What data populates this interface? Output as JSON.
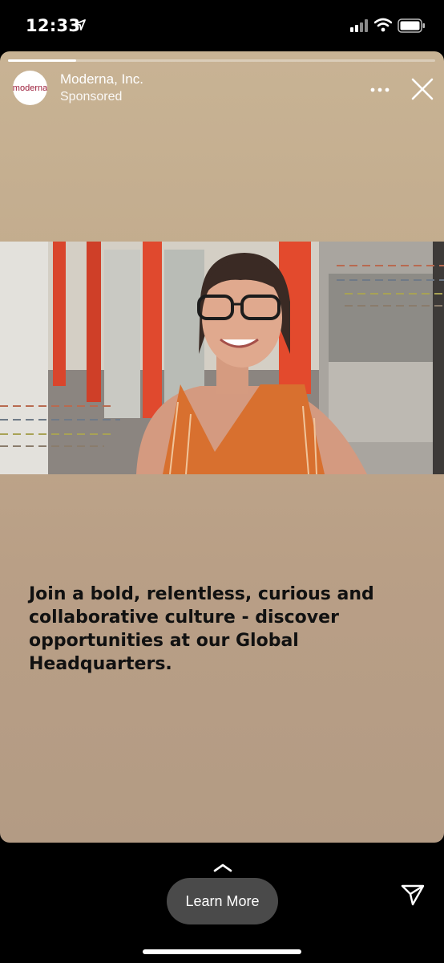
{
  "status_bar": {
    "time": "12:33",
    "icons": [
      "location-arrow-icon",
      "cellular-signal-icon",
      "wifi-icon",
      "battery-icon"
    ]
  },
  "story": {
    "progress": 0.16,
    "advertiser": {
      "name": "Moderna, Inc.",
      "label": "Sponsored",
      "avatar_text": "moderna"
    },
    "headline": "Join a bold, relentless, curious and collaborative culture - discover opportunities at our Global Headquarters.",
    "colors": {
      "background_top": "#c8b394",
      "background_bottom": "#b39b84",
      "text": "#111111"
    }
  },
  "footer": {
    "cta_label": "Learn More",
    "icons": [
      "chevron-up-icon",
      "send-icon"
    ]
  }
}
